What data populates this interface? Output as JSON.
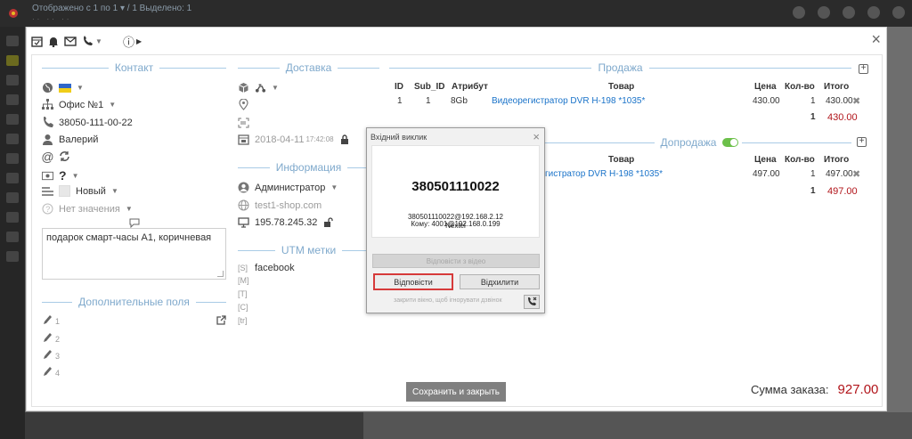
{
  "topbar": {
    "breadcrumb": "Отображено с 1 по 1 ▾   / 1 Выделено: 1",
    "sub": "··  ··  ··"
  },
  "modal": {
    "close": "×",
    "info_icon": "ⓘ",
    "sections": {
      "contact": "Контакт",
      "delivery": "Доставка",
      "sale": "Продажа",
      "upsale": "Допродажа",
      "info": "Информация",
      "utm": "UTM метки",
      "extra": "Дополнительные поля"
    },
    "contact": {
      "office": "Офис №1",
      "phone": "38050-111-00-22",
      "name": "Валерий",
      "question": "?",
      "status": "Новый",
      "no_value": "Нет значения",
      "comment": "подарок смарт-часы А1, коричневая"
    },
    "extra_fields": [
      "1",
      "2",
      "3",
      "4"
    ],
    "delivery": {
      "date": "2018-04-11",
      "time": "17:42:08"
    },
    "info": {
      "manager": "Администратор",
      "site": "test1-shop.com",
      "ip": "195.78.245.32"
    },
    "utm": {
      "source": "facebook",
      "labels": [
        "[S]",
        "[M]",
        "[T]",
        "[C]",
        "[tr]"
      ]
    },
    "sale": {
      "headers": {
        "id": "ID",
        "sub_id": "Sub_ID",
        "attr": "Атрибут",
        "product": "Товар",
        "price": "Цена",
        "qty": "Кол-во",
        "total": "Итого"
      },
      "rows": [
        {
          "id": "1",
          "sub_id": "1",
          "attr": "8Gb",
          "product": "Видеорегистратор DVR H-198 *1035*",
          "price": "430.00",
          "qty": "1",
          "total": "430.00"
        }
      ],
      "sum_qty": "1",
      "sum_total": "430.00"
    },
    "upsale": {
      "headers": {
        "product": "Товар",
        "price": "Цена",
        "qty": "Кол-во",
        "total": "Итого"
      },
      "rows": [
        {
          "product": "гистратор DVR H-198 *1035*",
          "price": "497.00",
          "qty": "1",
          "total": "497.00"
        }
      ],
      "sum_qty": "1",
      "sum_total": "497.00"
    },
    "save_label": "Сохранить и закрыть",
    "order_sum_label": "Сумма заказа:",
    "order_sum_value": "927.00"
  },
  "call_popup": {
    "title": "Вхідний виклик",
    "close": "×",
    "number": "380501110022",
    "sip": "380501110022@192.168.2.12",
    "operator": "Nextel",
    "to": "Кому: 4001@192.168.0.199",
    "video_label": "Відповісти з відео",
    "answer_label": "Відповісти",
    "reject_label": "Відхилити",
    "hint": "закрити вікно, щоб ігнорувати дзвінок"
  },
  "colors": {
    "accent": "#7fa9cc",
    "price_red": "#b1141a",
    "link": "#1a73c9",
    "answer_border": "#d63a3a"
  }
}
